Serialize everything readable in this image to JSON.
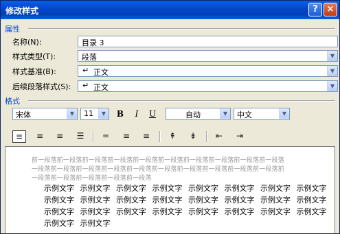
{
  "window": {
    "title": "修改样式",
    "help_label": "?",
    "close_label": "×"
  },
  "properties": {
    "section_title": "属性",
    "name": {
      "label": "名称(N):",
      "value": "目录 3"
    },
    "style_type": {
      "label": "样式类型(T):",
      "value": "段落"
    },
    "based_on": {
      "label": "样式基准(B):",
      "symbol": "↵",
      "value": "正文"
    },
    "next_style": {
      "label": "后续段落样式(S):",
      "symbol": "↵",
      "value": "正文"
    }
  },
  "format": {
    "section_title": "格式",
    "font": "宋体",
    "size": "11",
    "bold": "B",
    "italic": "I",
    "underline": "U",
    "color": "自动",
    "script": "中文"
  },
  "alignment_buttons": [
    "align-left",
    "align-center",
    "align-right",
    "align-justify",
    "spacing-single",
    "spacing-1-5",
    "spacing-double",
    "space-before",
    "space-after",
    "indent-decrease",
    "indent-increase"
  ],
  "preview": {
    "prev_paragraph_lines": [
      "前一段落前一段落前一段落前一段落前一段落前一段落前一段落前一段落前一段落前一段落",
      "一段落前一段落前一段落前一段落前一段落前一段落前一段落前一段落前一段落前一段落前",
      "一段落前一段落前一段落前一段落前一段落"
    ],
    "sample_lines": [
      "示例文字 示例文字 示例文字 示例文字 示例文字 示例文字 示例文字 示例文字",
      "示例文字 示例文字 示例文字 示例文字 示例文字 示例文字 示例文字 示例文字",
      "示例文字 示例文字 示例文字 示例文字 示例文字 示例文字 示例文字 示例文字",
      "示例文字 示例文字"
    ]
  }
}
